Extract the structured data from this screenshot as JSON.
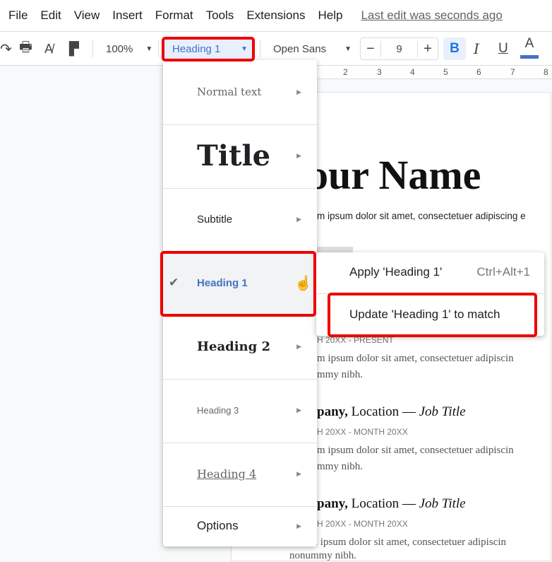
{
  "menubar": {
    "items": [
      "File",
      "Edit",
      "View",
      "Insert",
      "Format",
      "Tools",
      "Extensions",
      "Help"
    ],
    "last_edit": "Last edit was seconds ago"
  },
  "toolbar": {
    "zoom": "100%",
    "style": "Heading 1",
    "font": "Open Sans",
    "font_size": "9",
    "bold": "B",
    "italic": "I",
    "underline": "U",
    "text_color": "A",
    "text_color_value": "#4472c4",
    "minus": "−",
    "plus": "+"
  },
  "ruler": [
    "2",
    "3",
    "4",
    "5",
    "6",
    "7",
    "8"
  ],
  "document": {
    "name": "our Name",
    "intro": "m ipsum dolor sit amet, consectetuer adipiscing e",
    "date1": "H 20XX - PRESENT",
    "body1a": "m ipsum dolor sit amet, consectetuer adipiscin",
    "body1b": "mmy nibh.",
    "job2_company": "pany,",
    "job2_loc": " Location — ",
    "job2_title": "Job Title",
    "date2": "H 20XX - MONTH 20XX",
    "body2a": "m ipsum dolor sit amet, consectetuer adipiscin",
    "body2b": "mmy nibh.",
    "job3_company": "pany,",
    "job3_loc": " Location — ",
    "job3_title": "Job Title",
    "date3": "H 20XX - MONTH 20XX",
    "body3a": "Lorem ipsum dolor sit amet, consectetuer adipiscin",
    "body3b": "nonummy nibh."
  },
  "style_menu": {
    "items": [
      "Normal text",
      "Title",
      "Subtitle",
      "Heading 1",
      "Heading 2",
      "Heading 3",
      "Heading 4",
      "Options"
    ],
    "checked": "✔"
  },
  "submenu": {
    "apply": "Apply 'Heading 1'",
    "apply_shortcut": "Ctrl+Alt+1",
    "update": "Update 'Heading 1' to match"
  }
}
